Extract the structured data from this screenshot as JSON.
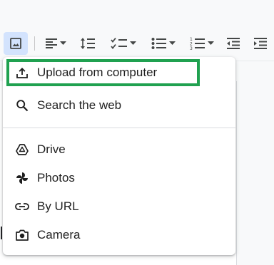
{
  "menu": {
    "items": [
      {
        "label": "Upload from computer",
        "icon": "upload-icon"
      },
      {
        "label": "Search the web",
        "icon": "search-icon"
      },
      {
        "label": "Drive",
        "icon": "drive-icon"
      },
      {
        "label": "Photos",
        "icon": "photos-icon"
      },
      {
        "label": "By URL",
        "icon": "link-icon"
      },
      {
        "label": "Camera",
        "icon": "camera-icon"
      }
    ]
  },
  "toolbar": {
    "buttons": [
      "image-icon",
      "align-left-icon",
      "line-spacing-icon",
      "checklist-icon",
      "bulleted-list-icon",
      "numbered-list-icon",
      "decrease-indent-icon",
      "increase-indent-icon"
    ]
  },
  "colors": {
    "highlight": "#20a150",
    "active_button": "#d3e3fd",
    "toolbar_bg": "#f8f9fa"
  }
}
